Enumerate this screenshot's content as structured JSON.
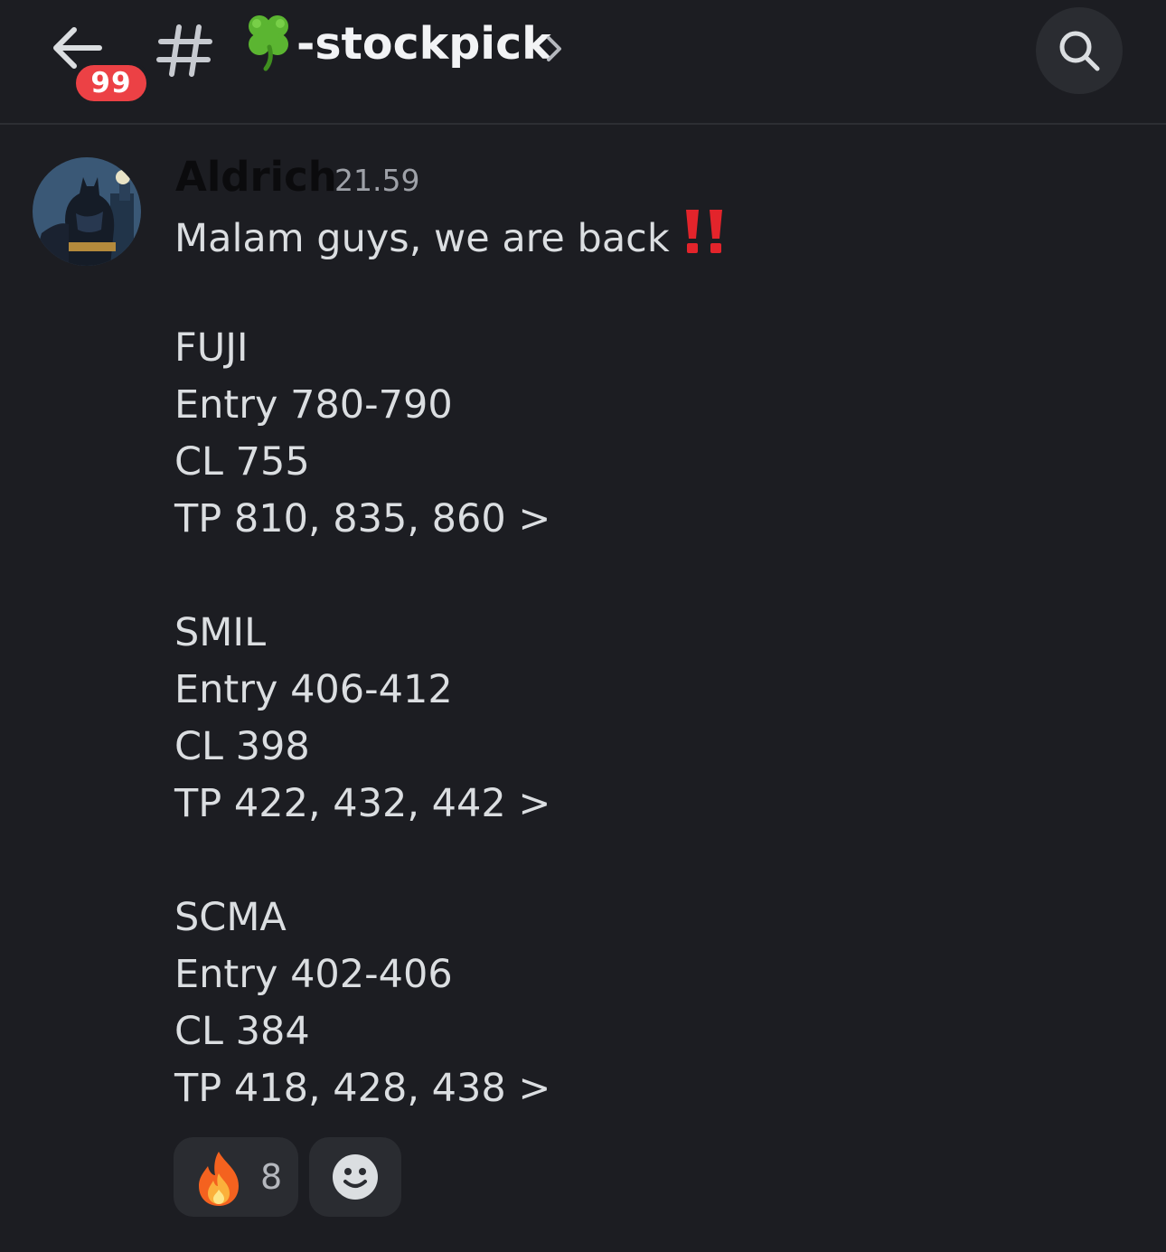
{
  "header": {
    "back_icon": "arrow-left-icon",
    "unread_badge": "99",
    "channel_icon": "hash-icon",
    "channel_emoji": "four-leaf-clover",
    "channel_name": "-stockpick",
    "chevron_icon": "chevron-right-icon",
    "search_icon": "search-icon"
  },
  "message": {
    "author": "Aldrich",
    "timestamp": "21.59",
    "greeting": "Malam guys, we are back",
    "emphasis_icon": "double-exclamation-icon",
    "lines": [
      "FUJI",
      "Entry 780-790",
      "CL 755",
      "TP 810, 835, 860 >",
      "SMIL",
      "Entry 406-412",
      "CL 398",
      "TP 422, 432, 442 >",
      "SCMA",
      "Entry 402-406",
      "CL 384",
      "TP 418, 428, 438 >"
    ]
  },
  "reactions": [
    {
      "emoji": "fire",
      "count": "8"
    }
  ],
  "add_reaction_icon": "smiley-add-reaction-icon",
  "colors": {
    "background": "#1c1d22",
    "badge": "#ec4145",
    "text": "#dbdee1",
    "muted": "#9ea1a8",
    "reaction_bg": "#2a2c31"
  }
}
